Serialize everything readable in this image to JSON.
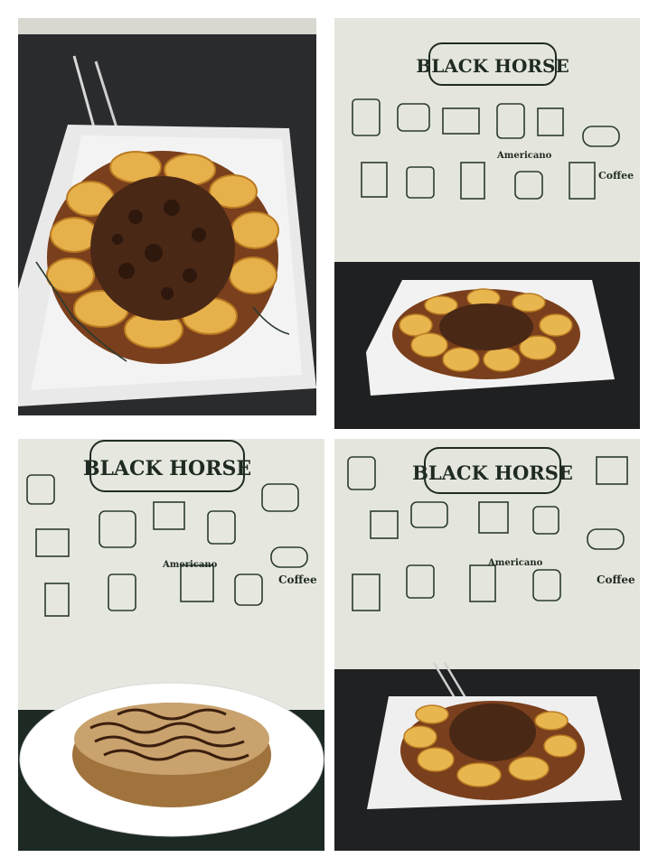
{
  "collage": {
    "tiles": [
      {
        "name": "waffle-plate-closeup",
        "sign": ""
      },
      {
        "name": "waffle-cafe-wall",
        "sign": "BLACK HORSE"
      },
      {
        "name": "pancake-white-plate",
        "sign": "BLACK HORSE"
      },
      {
        "name": "waffle-plate-wall",
        "sign": "BLACK HORSE"
      }
    ],
    "wall_labels": {
      "americano": "Americano",
      "coffee": "Coffee"
    }
  }
}
